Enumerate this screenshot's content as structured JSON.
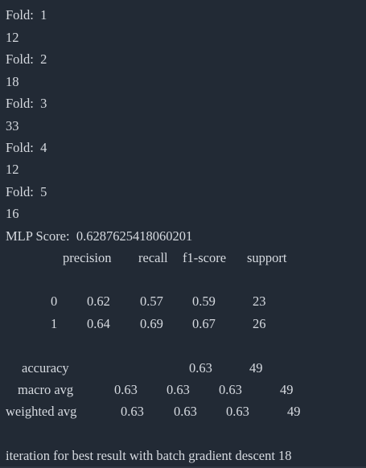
{
  "folds": [
    {
      "label": "Fold:  1",
      "value": "12"
    },
    {
      "label": "Fold:  2",
      "value": "18"
    },
    {
      "label": "Fold:  3",
      "value": "33"
    },
    {
      "label": "Fold:  4",
      "value": "12"
    },
    {
      "label": "Fold:  5",
      "value": "16"
    }
  ],
  "mlp_score": "MLP Score:  0.6287625418060201",
  "report": {
    "headers": [
      "precision",
      "recall",
      "f1-score",
      "support"
    ],
    "rows": [
      {
        "label": "0",
        "precision": "0.62",
        "recall": "0.57",
        "f1": "0.59",
        "support": "23"
      },
      {
        "label": "1",
        "precision": "0.64",
        "recall": "0.69",
        "f1": "0.67",
        "support": "26"
      }
    ],
    "accuracy": {
      "label": "accuracy",
      "f1": "0.63",
      "support": "49"
    },
    "macro_avg": {
      "label": "macro avg",
      "precision": "0.63",
      "recall": "0.63",
      "f1": "0.63",
      "support": "49"
    },
    "weighted_avg": {
      "label": "weighted avg",
      "precision": "0.63",
      "recall": "0.63",
      "f1": "0.63",
      "support": "49"
    }
  },
  "final_line": "iteration for best result with batch gradient descent 18"
}
